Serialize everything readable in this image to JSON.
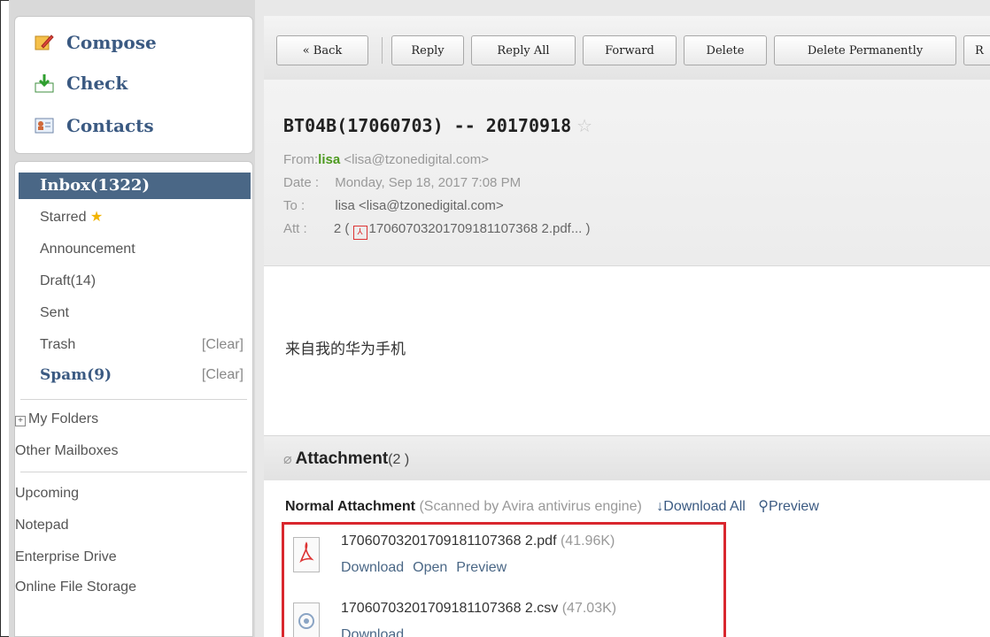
{
  "sidebar": {
    "compose": "Compose",
    "check": "Check",
    "contacts": "Contacts",
    "inbox": "Inbox(1322)",
    "starred": "Starred",
    "announcement": "Announcement",
    "draft": "Draft(14)",
    "sent": "Sent",
    "trash": "Trash",
    "spam": "Spam(9)",
    "clear_label": "[Clear]",
    "my_folders": "My Folders",
    "other_mailboxes": "Other Mailboxes",
    "upcoming": "Upcoming",
    "notepad": "Notepad",
    "enterprise_drive": "Enterprise Drive",
    "online_file_storage": "Online File Storage"
  },
  "toolbar": {
    "back": "« Back",
    "reply": "Reply",
    "reply_all": "Reply All",
    "forward": "Forward",
    "delete": "Delete",
    "delete_permanently": "Delete Permanently",
    "cutoff": "R"
  },
  "message": {
    "subject": "BT04B(17060703) -- 20170918",
    "from_label": "From:",
    "from_name": "lisa",
    "from_email": "<lisa@tzonedigital.com>",
    "date_label": "Date :",
    "date_value": "Monday, Sep 18, 2017 7:08 PM",
    "to_label": "To :",
    "to_value": "lisa <lisa@tzonedigital.com>",
    "att_label": "Att :",
    "att_value": "2 ( ",
    "att_file": "17060703201709181107368 2.pdf... )",
    "body": "来自我的华为手机"
  },
  "attachments": {
    "title": "Attachment",
    "count": "(2 )",
    "normal_label": "Normal Attachment",
    "scanned": "(Scanned by Avira antivirus engine)",
    "download_all": "Download All",
    "preview": "Preview",
    "files": [
      {
        "name": "17060703201709181107368 2.pdf",
        "size": "(41.96K)",
        "actions": [
          "Download",
          "Open",
          "Preview"
        ]
      },
      {
        "name": "17060703201709181107368 2.csv",
        "size": "(47.03K)",
        "actions": [
          "Download"
        ]
      }
    ]
  },
  "colors": {
    "accent": "#4a6786",
    "highlight": "#d9272e",
    "sender": "#4d9a1f"
  }
}
